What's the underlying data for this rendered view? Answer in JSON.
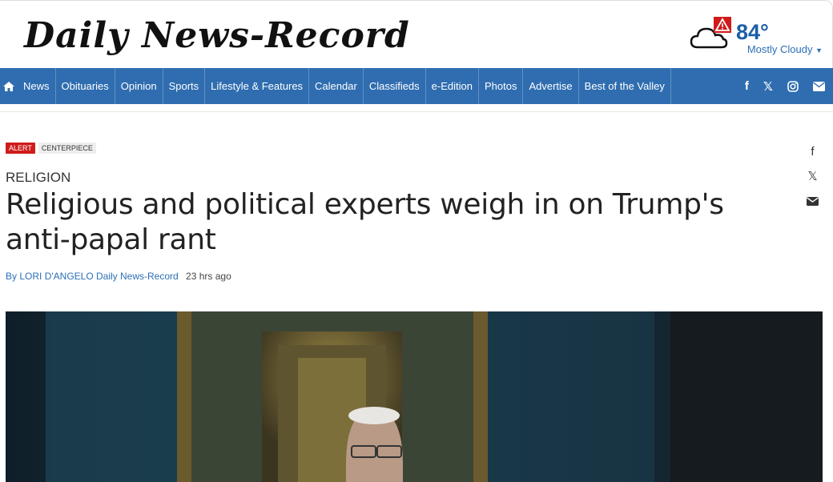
{
  "site": {
    "title": "Daily News-Record"
  },
  "weather": {
    "temperature": "84°",
    "condition": "Mostly Cloudy",
    "alert_icon": "warning-icon",
    "icon": "cloudy-icon"
  },
  "nav": {
    "items": [
      {
        "label": "News"
      },
      {
        "label": "Obituaries"
      },
      {
        "label": "Opinion"
      },
      {
        "label": "Sports"
      },
      {
        "label": "Lifestyle & Features"
      },
      {
        "label": "Calendar"
      },
      {
        "label": "Classifieds"
      },
      {
        "label": "e-Edition"
      },
      {
        "label": "Photos"
      },
      {
        "label": "Advertise"
      },
      {
        "label": "Best of the Valley"
      }
    ],
    "social": {
      "facebook": "f",
      "x": "𝕏"
    }
  },
  "article": {
    "tags": [
      "ALERT",
      "CENTERPIECE"
    ],
    "section": "RELIGION",
    "headline": "Religious and political experts weigh in on Trump's anti-papal rant",
    "byline_prefix": "By",
    "author": "LORI D'ANGELO Daily News-Record",
    "time": "23 hrs ago"
  },
  "share": {
    "facebook": "f",
    "x": "𝕏"
  },
  "colors": {
    "nav_bg": "#2f6db0",
    "alert": "#d01b1b",
    "link": "#2b6fb7"
  }
}
